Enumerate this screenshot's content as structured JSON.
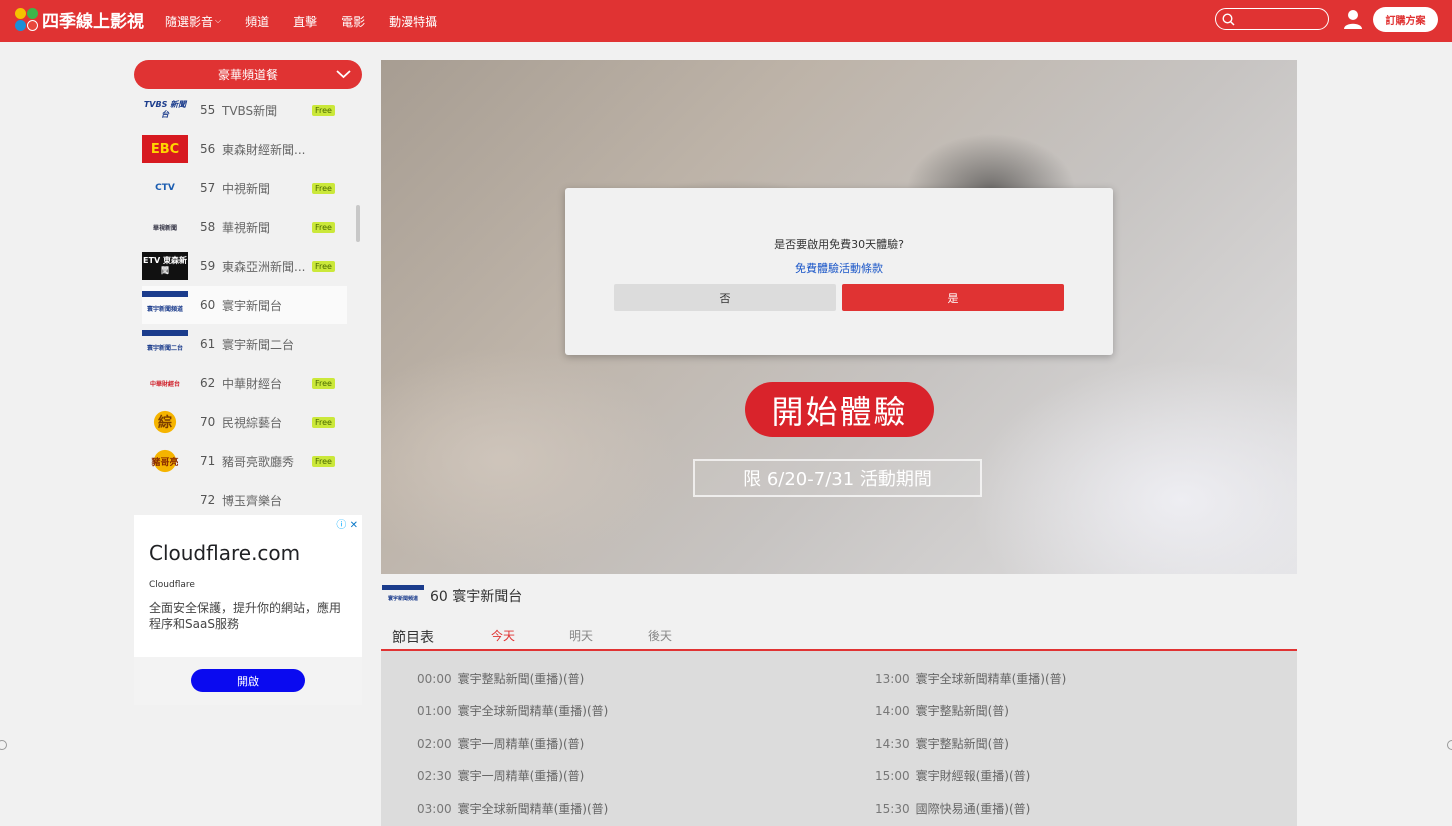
{
  "header": {
    "logo_text": "四季線上影視",
    "nav": [
      "隨選影音",
      "頻道",
      "直擊",
      "電影",
      "動漫特攝"
    ],
    "subscribe_label": "訂購方案",
    "search_placeholder": ""
  },
  "sidebar": {
    "package_label": "豪華頻道餐",
    "channels": [
      {
        "num": "55",
        "name": "TVBS新聞",
        "free": "Free",
        "logo": "TVBS 新聞台"
      },
      {
        "num": "56",
        "name": "東森財經新聞...",
        "free": "",
        "logo": "EBC"
      },
      {
        "num": "57",
        "name": "中視新聞",
        "free": "Free",
        "logo": "CTV"
      },
      {
        "num": "58",
        "name": "華視新聞",
        "free": "Free",
        "logo": "華視新聞"
      },
      {
        "num": "59",
        "name": "東森亞洲新聞...",
        "free": "Free",
        "logo": "ETV 東森新聞"
      },
      {
        "num": "60",
        "name": "寰宇新聞台",
        "free": "",
        "logo": "寰宇新聞頻道"
      },
      {
        "num": "61",
        "name": "寰宇新聞二台",
        "free": "",
        "logo": "寰宇新聞二台"
      },
      {
        "num": "62",
        "name": "中華財經台",
        "free": "Free",
        "logo": "中華財經台"
      },
      {
        "num": "70",
        "name": "民視綜藝台",
        "free": "Free",
        "logo": "綜"
      },
      {
        "num": "71",
        "name": "豬哥亮歌廳秀",
        "free": "Free",
        "logo": "豬哥亮"
      },
      {
        "num": "72",
        "name": "博玉齊樂台",
        "free": "",
        "logo": ""
      }
    ]
  },
  "ad": {
    "title": "Cloudflare.com",
    "brand": "Cloudflare",
    "description": "全面安全保護，提升你的網站，應用程序和SaaS服務",
    "button": "開啟",
    "info_icon": "ⓘ",
    "close_icon": "✕"
  },
  "dialog": {
    "question": "是否要啟用免費30天體驗?",
    "terms_link": "免費體驗活動條款",
    "no_label": "否",
    "yes_label": "是"
  },
  "promo": {
    "start_label": "開始體驗",
    "period_label": "限 6/20-7/31 活動期間"
  },
  "current_channel": {
    "num": "60",
    "name": "寰宇新聞台",
    "logo": "寰宇新聞頻道"
  },
  "guide": {
    "title": "節目表",
    "tabs": [
      "今天",
      "明天",
      "後天"
    ],
    "left": [
      {
        "time": "00:00",
        "title": "寰宇整點新聞(重播)(普)"
      },
      {
        "time": "01:00",
        "title": "寰宇全球新聞精華(重播)(普)"
      },
      {
        "time": "02:00",
        "title": "寰宇一周精華(重播)(普)"
      },
      {
        "time": "02:30",
        "title": "寰宇一周精華(重播)(普)"
      },
      {
        "time": "03:00",
        "title": "寰宇全球新聞精華(重播)(普)"
      }
    ],
    "right": [
      {
        "time": "13:00",
        "title": "寰宇全球新聞精華(重播)(普)"
      },
      {
        "time": "14:00",
        "title": "寰宇整點新聞(普)"
      },
      {
        "time": "14:30",
        "title": "寰宇整點新聞(普)"
      },
      {
        "time": "15:00",
        "title": "寰宇財經報(重播)(普)"
      },
      {
        "time": "15:30",
        "title": "國際快易通(重播)(普)"
      }
    ]
  },
  "colors": {
    "brand_red": "#e03333",
    "free_badge": "#cbe83a",
    "ad_button": "#0a0af0"
  }
}
